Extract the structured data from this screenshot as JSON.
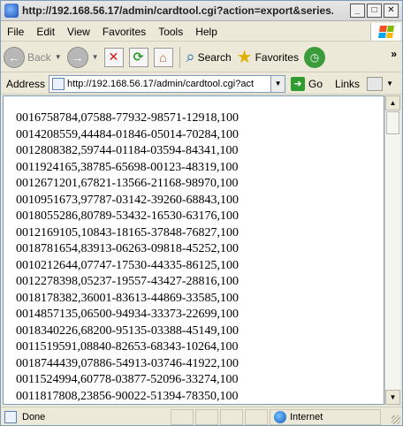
{
  "window": {
    "title": "http://192.168.56.17/admin/cardtool.cgi?action=export&series..."
  },
  "menu": [
    "File",
    "Edit",
    "View",
    "Favorites",
    "Tools",
    "Help"
  ],
  "toolbar": {
    "back_label": "Back",
    "search_label": "Search",
    "favorites_label": "Favorites"
  },
  "addressbar": {
    "label": "Address",
    "url": "http://192.168.56.17/admin/cardtool.cgi?act",
    "go_label": "Go",
    "links_label": "Links"
  },
  "content": {
    "lines": [
      "0016758784,07588-77932-98571-12918,100",
      "0014208559,44484-01846-05014-70284,100",
      "0012808382,59744-01184-03594-84341,100",
      "0011924165,38785-65698-00123-48319,100",
      "0012671201,67821-13566-21168-98970,100",
      "0010951673,97787-03142-39260-68843,100",
      "0018055286,80789-53432-16530-63176,100",
      "0012169105,10843-18165-37848-76827,100",
      "0018781654,83913-06263-09818-45252,100",
      "0010212644,07747-17530-44335-86125,100",
      "0012278398,05237-19557-43427-28816,100",
      "0018178382,36001-83613-44869-33585,100",
      "0014857135,06500-94934-33373-22699,100",
      "0018340226,68200-95135-03388-45149,100",
      "0011519591,08840-82653-68343-10264,100",
      "0018744439,07886-54913-03746-41922,100",
      "0011524994,60778-03877-52096-33274,100",
      "0011817808,23856-90022-51394-78350,100"
    ]
  },
  "statusbar": {
    "text": "Done",
    "zone": "Internet"
  }
}
